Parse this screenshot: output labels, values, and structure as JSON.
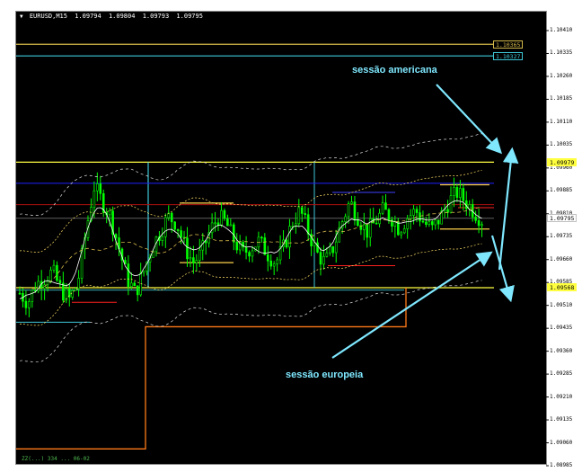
{
  "header": {
    "symbol": "EURUSD,M15",
    "open": "1.09794",
    "high": "1.09804",
    "low": "1.09793",
    "close": "1.09795"
  },
  "axis": {
    "ticks": [
      "1.10410",
      "1.10335",
      "1.10260",
      "1.10185",
      "1.10110",
      "1.10035",
      "1.09960",
      "1.09885",
      "1.09810",
      "1.09735",
      "1.09660",
      "1.09585",
      "1.09510",
      "1.09435",
      "1.09360",
      "1.09285",
      "1.09210",
      "1.09135",
      "1.09060",
      "1.08985"
    ]
  },
  "levels": [
    {
      "label": "1.10365",
      "price": 1.10365,
      "color": "#d4b84a",
      "text_color": "#000000",
      "bg": "#000000",
      "fg": "#d4b84a"
    },
    {
      "label": "1.10327",
      "price": 1.10327,
      "color": "#3ec8d8",
      "text_color": "#3ec8d8",
      "bg": "#000000",
      "fg": "#3ec8d8"
    },
    {
      "label": "1.09979",
      "price": 1.09979,
      "color": "#ffff40",
      "text_color": "#000000",
      "bg": "#ffff40",
      "fg": "#000000"
    },
    {
      "label": "1.09568",
      "price": 1.09568,
      "color": "#ffff40",
      "text_color": "#000000",
      "bg": "#ffff40",
      "fg": "#000000"
    },
    {
      "label": "1.09795",
      "price": 1.09795,
      "color": "#c0c0c0",
      "text_color": "#000000",
      "bg": "#ffffff",
      "fg": "#000000"
    }
  ],
  "annotations": {
    "americana": "sessão americana",
    "europeia": "sessão europeia"
  },
  "footer": "ZZ(...) 334 ... 06-02",
  "colors": {
    "candle": "#00ff00",
    "background": "#000000",
    "annotation": "#7fe8ff"
  },
  "chart_data": {
    "type": "candlestick",
    "symbol": "EURUSD",
    "timeframe": "M15",
    "ylim": [
      1.08985,
      1.1041
    ],
    "horizontal_levels": [
      1.10365,
      1.10327,
      1.09979,
      1.09568,
      1.09795
    ],
    "last_price": 1.09795,
    "close_trend": [
      1.0955,
      1.0952,
      1.0958,
      1.096,
      1.0962,
      1.0956,
      1.0953,
      1.0958,
      1.0975,
      1.099,
      1.0985,
      1.098,
      1.097,
      1.096,
      1.0955,
      1.0962,
      1.097,
      1.0975,
      1.098,
      1.0978,
      1.097,
      1.0965,
      1.0968,
      1.0975,
      1.098,
      1.0978,
      1.0972,
      1.0968,
      1.097,
      1.0972,
      1.0968,
      1.0965,
      1.097,
      1.0978,
      1.0982,
      1.0975,
      1.0968,
      1.0965,
      1.097,
      1.0978,
      1.0985,
      1.098,
      1.0975,
      1.0978,
      1.0982,
      1.098,
      1.0976,
      1.098,
      1.0982,
      1.0978,
      1.0976,
      1.098,
      1.0985,
      1.0988,
      1.0985,
      1.0982,
      1.0979
    ]
  }
}
